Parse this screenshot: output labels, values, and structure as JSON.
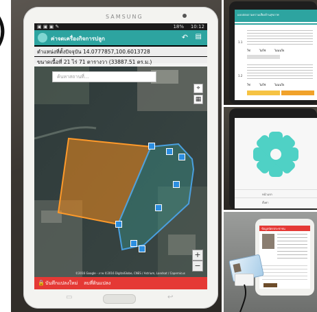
{
  "main_tablet": {
    "brand": "SAMSUNG",
    "status": {
      "battery": "18%",
      "time": "10:12"
    },
    "app_title": "ค่าจดเครื่องกิจการปลูก",
    "position_line": "ตำแหน่งที่ตั้งปัจจุบัน 14.0777857,100.6013728",
    "area_line": "ขนาดเนื้อที่ 21 ไร่ 71 ตารางวา (33887.51 ตร.ม.)",
    "search_placeholder": "ค้นหาสถานที่...",
    "save_button": "บันทึกแปลงใหม่",
    "delete_button": "ลบที่ดินแปลง",
    "map_attribution": "©2016 Google - ภาพ ©2016 DigitalGlobe, CNES / Astrium, Landsat / Copernicus",
    "zoom_in": "+",
    "zoom_out": "−",
    "colors": {
      "accent": "#2da4a0",
      "plot_a": "#f08a1c",
      "plot_b": "#4aa0e0",
      "delete": "#e53935"
    }
  },
  "questionnaire_tablet": {
    "header_title": "แบบสอบถามความเสี่ยงด้านสุขภาพ",
    "rows": [
      {
        "num": "1.1",
        "choices": [
          "ใช่",
          "ไม่ใช่",
          "ไม่แน่ใจ"
        ]
      },
      {
        "num": "1.2",
        "choices": [
          "ใช่",
          "ไม่ใช่",
          "ไม่แน่ใจ"
        ]
      }
    ]
  },
  "splash_tablet": {
    "menu_items": [
      "หน้าแรก",
      "ตั้งค่า"
    ]
  },
  "cardreader_photo": {
    "app_header": "ข้อมูลบัตรประชาชน"
  }
}
